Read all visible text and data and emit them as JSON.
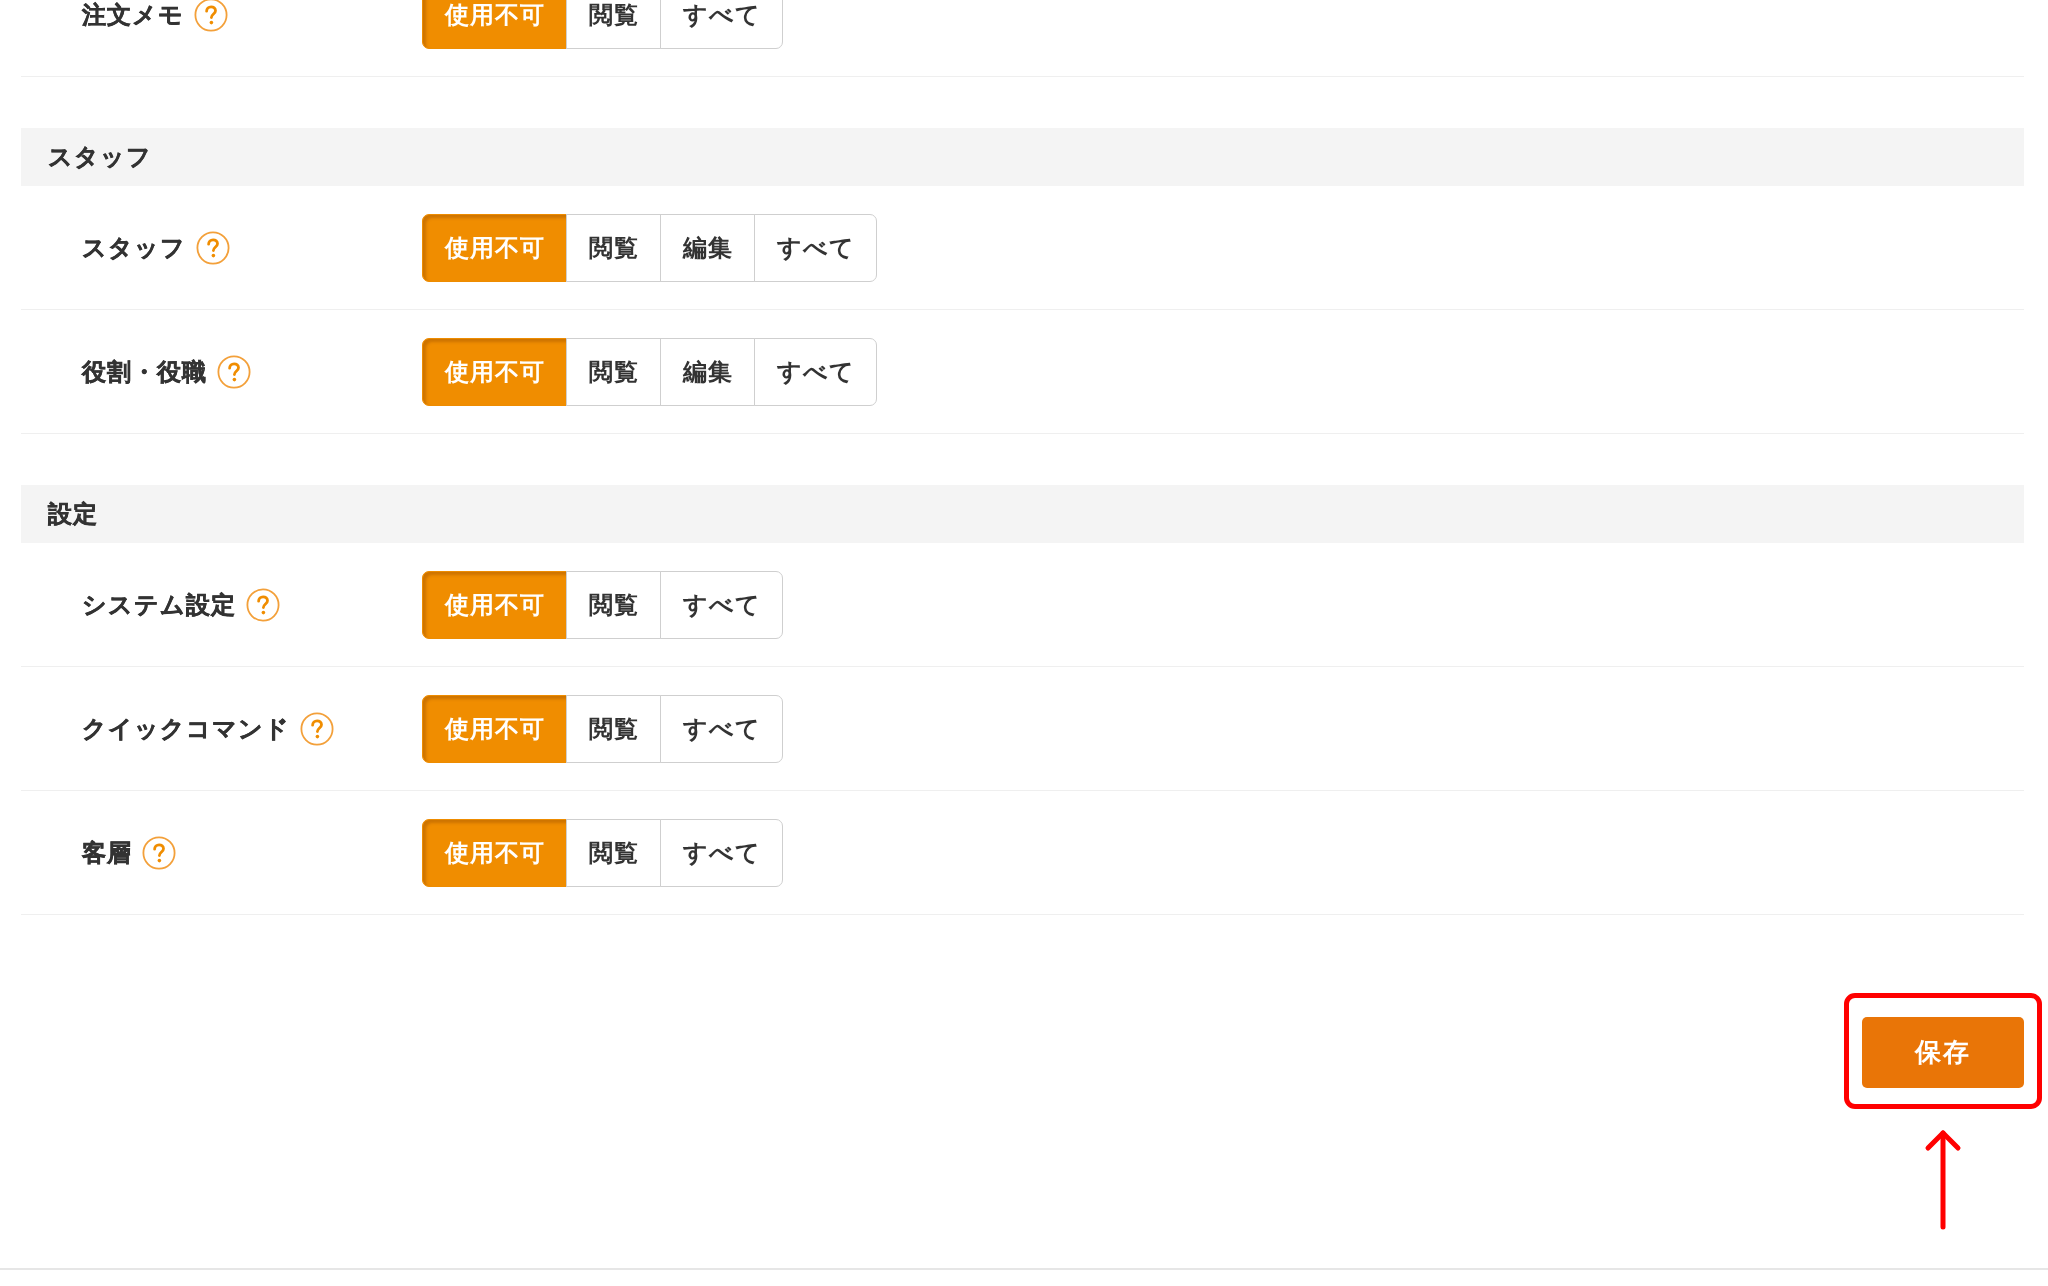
{
  "sections": [
    {
      "rows": [
        {
          "label": "注文メモ",
          "options": [
            {
              "label": "使用不可",
              "selected": true
            },
            {
              "label": "閲覧",
              "selected": false
            },
            {
              "label": "すべて",
              "selected": false
            }
          ]
        }
      ]
    },
    {
      "title": "スタッフ",
      "rows": [
        {
          "label": "スタッフ",
          "options": [
            {
              "label": "使用不可",
              "selected": true
            },
            {
              "label": "閲覧",
              "selected": false
            },
            {
              "label": "編集",
              "selected": false
            },
            {
              "label": "すべて",
              "selected": false
            }
          ]
        },
        {
          "label": "役割・役職",
          "options": [
            {
              "label": "使用不可",
              "selected": true
            },
            {
              "label": "閲覧",
              "selected": false
            },
            {
              "label": "編集",
              "selected": false
            },
            {
              "label": "すべて",
              "selected": false
            }
          ]
        }
      ]
    },
    {
      "title": "設定",
      "rows": [
        {
          "label": "システム設定",
          "options": [
            {
              "label": "使用不可",
              "selected": true
            },
            {
              "label": "閲覧",
              "selected": false
            },
            {
              "label": "すべて",
              "selected": false
            }
          ]
        },
        {
          "label": "クイックコマンド",
          "options": [
            {
              "label": "使用不可",
              "selected": true
            },
            {
              "label": "閲覧",
              "selected": false
            },
            {
              "label": "すべて",
              "selected": false
            }
          ]
        },
        {
          "label": "客層",
          "options": [
            {
              "label": "使用不可",
              "selected": true
            },
            {
              "label": "閲覧",
              "selected": false
            },
            {
              "label": "すべて",
              "selected": false
            }
          ]
        }
      ]
    }
  ],
  "save_button": {
    "label": "保存"
  }
}
